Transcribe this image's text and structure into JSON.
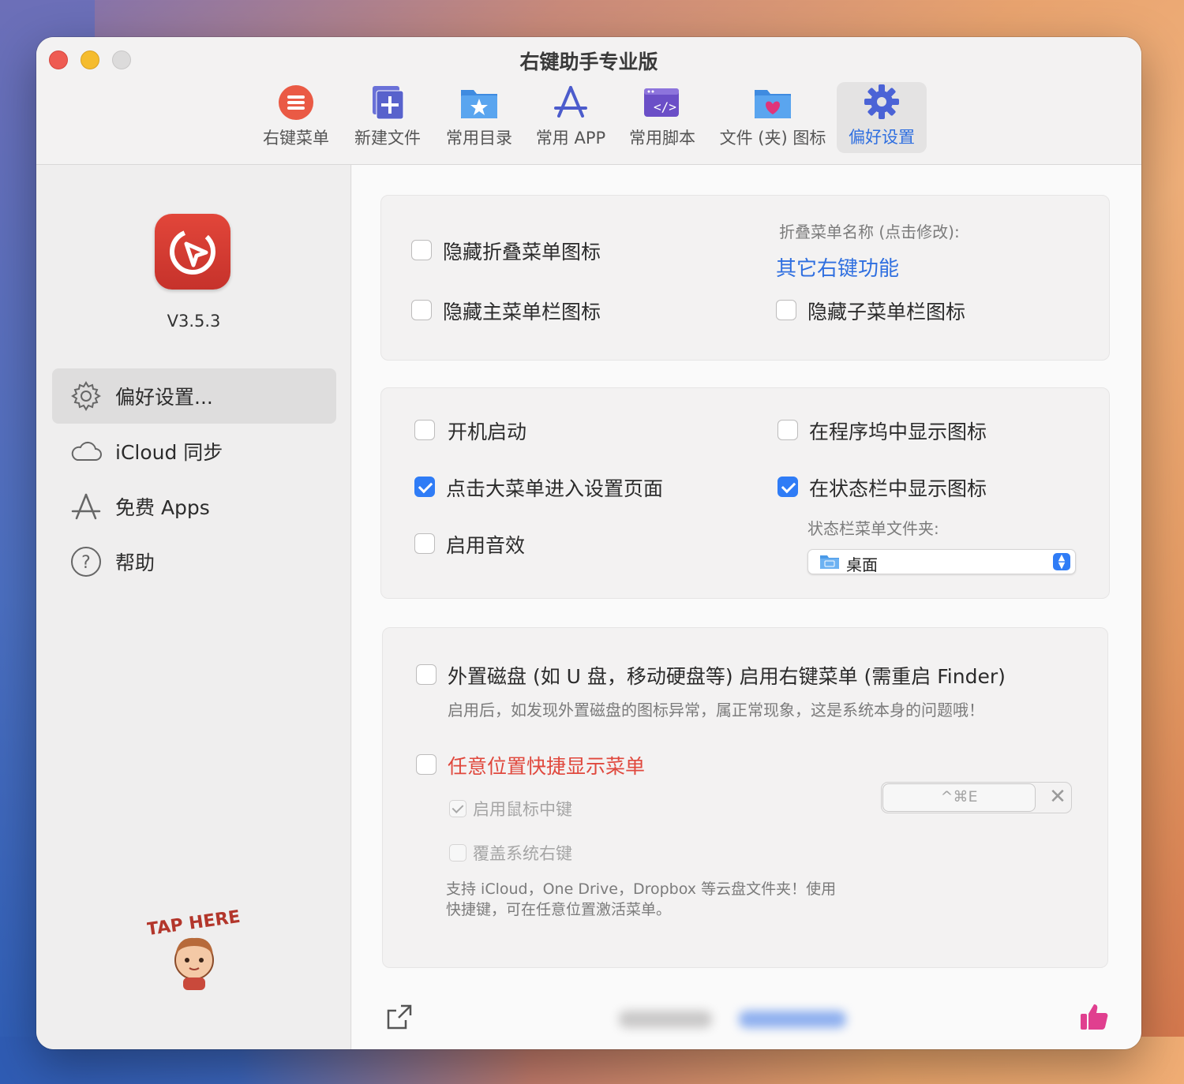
{
  "window": {
    "title": "右键助手专业版"
  },
  "toolbar": {
    "items": [
      {
        "label": "右键菜单",
        "icon": "menu-list-icon"
      },
      {
        "label": "新建文件",
        "icon": "new-file-icon"
      },
      {
        "label": "常用目录",
        "icon": "folder-star-icon"
      },
      {
        "label": "常用 APP",
        "icon": "app-store-icon"
      },
      {
        "label": "常用脚本",
        "icon": "script-icon"
      },
      {
        "label": "文件 (夹) 图标",
        "icon": "folder-heart-icon"
      },
      {
        "label": "偏好设置",
        "icon": "gear-icon",
        "active": true
      }
    ]
  },
  "sidebar": {
    "version": "V3.5.3",
    "items": [
      {
        "label": "偏好设置...",
        "icon": "gear-icon",
        "selected": true
      },
      {
        "label": "iCloud 同步",
        "icon": "cloud-icon"
      },
      {
        "label": "免费 Apps",
        "icon": "app-store-icon"
      },
      {
        "label": "帮助",
        "icon": "question-icon"
      }
    ],
    "tap_here": "TAP HERE"
  },
  "panel1": {
    "hide_fold_icon": "隐藏折叠菜单图标",
    "hide_main_icon": "隐藏主菜单栏图标",
    "fold_name_label": "折叠菜单名称 (点击修改):",
    "fold_name_value": "其它右键功能",
    "hide_sub_icon": "隐藏子菜单栏图标"
  },
  "panel2": {
    "launch_at_login": "开机启动",
    "click_big_menu": "点击大菜单进入设置页面",
    "enable_sound": "启用音效",
    "show_in_dock": "在程序坞中显示图标",
    "show_in_statusbar": "在状态栏中显示图标",
    "statusbar_folder_label": "状态栏菜单文件夹:",
    "statusbar_folder_value": "桌面"
  },
  "panel3": {
    "external_disk": "外置磁盘 (如 U 盘，移动硬盘等) 启用右键菜单 (需重启 Finder)",
    "external_disk_note": "启用后，如发现外置磁盘的图标异常，属正常现象，这是系统本身的问题哦！",
    "anywhere_menu": "任意位置快捷显示菜单",
    "shortcut": "^⌘E",
    "middle_click": "启用鼠标中键",
    "override_right": "覆盖系统右键",
    "note_line1": "支持 iCloud，One Drive，Dropbox 等云盘文件夹！使用",
    "note_line2": "快捷键，可在任意位置激活菜单。"
  },
  "colors": {
    "accent": "#2f6fe0",
    "checkbox_on": "#2f7cf6",
    "warning_red": "#e0483d",
    "app_icon_red": "#d23a30"
  }
}
